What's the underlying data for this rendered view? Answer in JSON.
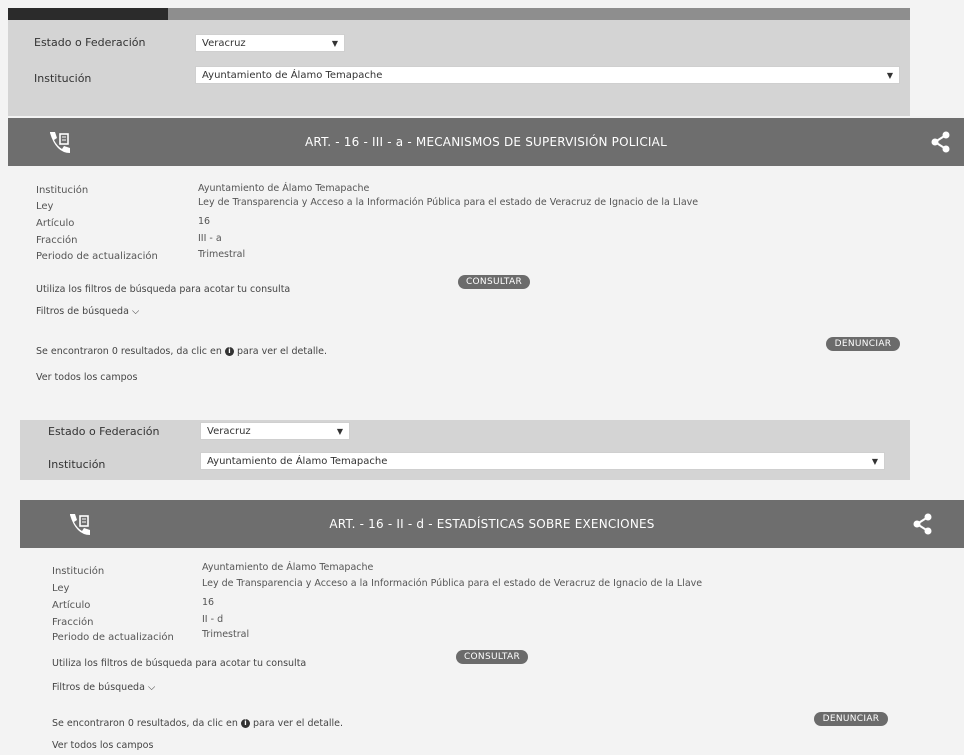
{
  "colors": {
    "banner": "#6e6e6e",
    "filter_bg": "#d4d4d4",
    "pill": "#6b6b6b"
  },
  "sections": [
    {
      "filters": {
        "estado_label": "Estado o Federación",
        "estado_value": "Veracruz",
        "institucion_label": "Institución",
        "institucion_value": "Ayuntamiento de Álamo Temapache"
      },
      "banner": {
        "title": "ART. - 16 - III - a - MECANISMOS DE SUPERVISIÓN POLICIAL",
        "icon": "phone-document-icon",
        "share_icon": "share-icon"
      },
      "info": {
        "institucion_label": "Institución",
        "institucion": "Ayuntamiento de Álamo Temapache",
        "ley_label": "Ley",
        "ley": "Ley de Transparencia y Acceso a la Información Pública para el estado de Veracruz de Ignacio de la Llave",
        "articulo_label": "Artículo",
        "articulo": "16",
        "fraccion_label": "Fracción",
        "fraccion": "III - a",
        "periodo_label": "Periodo de actualización",
        "periodo": "Trimestral"
      },
      "consultar": "CONSULTAR",
      "help": "Utiliza los filtros de búsqueda para acotar tu consulta",
      "filtros": "Filtros de búsqueda",
      "results_pre": "Se encontraron 0 resultados, da clic en",
      "results_post": "para ver el detalle.",
      "denunciar": "DENUNCIAR",
      "ver_todos": "Ver todos los campos"
    },
    {
      "filters": {
        "estado_label": "Estado o Federación",
        "estado_value": "Veracruz",
        "institucion_label": "Institución",
        "institucion_value": "Ayuntamiento de Álamo Temapache"
      },
      "banner": {
        "title": "ART. - 16 - II - d - ESTADÍSTICAS SOBRE EXENCIONES",
        "icon": "phone-document-icon",
        "share_icon": "share-icon"
      },
      "info": {
        "institucion_label": "Institución",
        "institucion": "Ayuntamiento de Álamo Temapache",
        "ley_label": "Ley",
        "ley": "Ley de Transparencia y Acceso a la Información Pública para el estado de Veracruz de Ignacio de la Llave",
        "articulo_label": "Artículo",
        "articulo": "16",
        "fraccion_label": "Fracción",
        "fraccion": "II - d",
        "periodo_label": "Periodo de actualización",
        "periodo": "Trimestral"
      },
      "consultar": "CONSULTAR",
      "help": "Utiliza los filtros de búsqueda para acotar tu consulta",
      "filtros": "Filtros de búsqueda",
      "results_pre": "Se encontraron 0 resultados, da clic en",
      "results_post": "para ver el detalle.",
      "denunciar": "DENUNCIAR",
      "ver_todos": "Ver todos los campos"
    }
  ]
}
